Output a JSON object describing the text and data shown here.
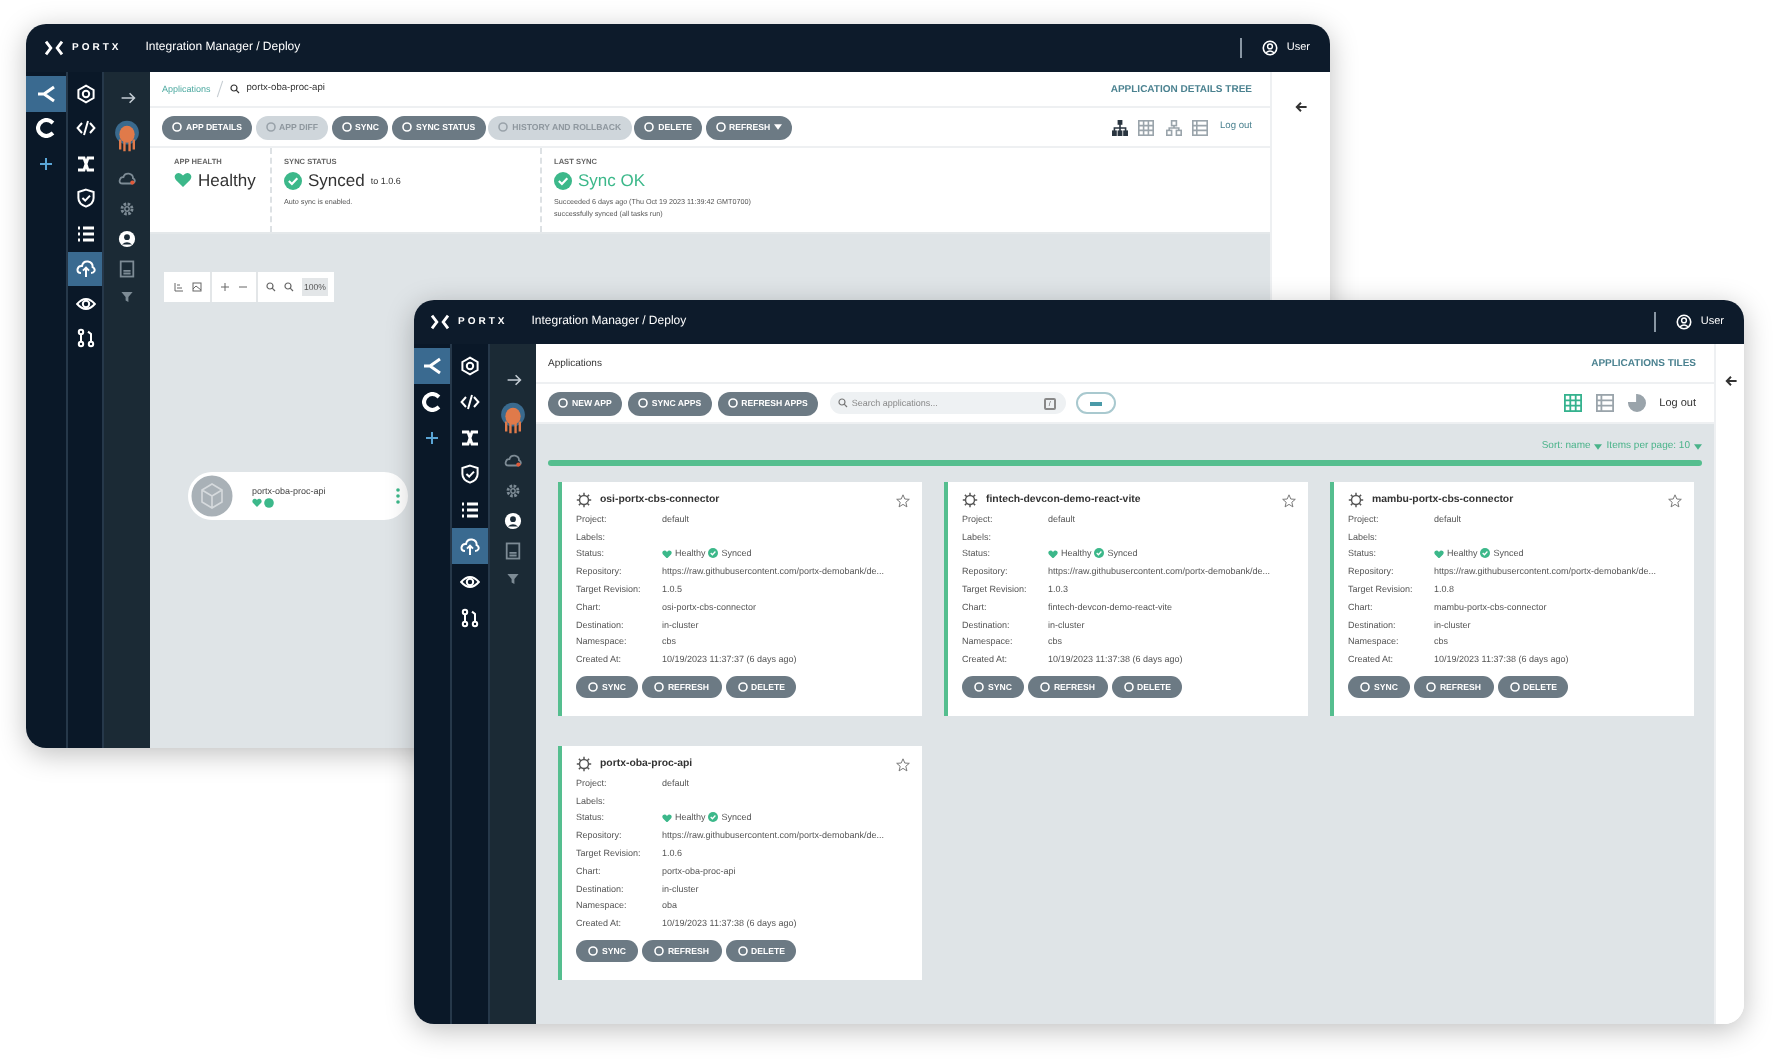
{
  "back_window": {
    "header": {
      "brand": "PORTX",
      "title": "Integration Manager / Deploy",
      "user": "User"
    },
    "primary_nav": [
      {
        "selected": true
      },
      {
        "selected": false
      },
      {
        "selected": false
      }
    ],
    "nav": [
      {
        "selected": false
      },
      {
        "selected": false
      },
      {
        "selected": false
      },
      {
        "selected": false
      },
      {
        "selected": false
      },
      {
        "selected": true
      },
      {
        "selected": false
      },
      {
        "selected": false
      }
    ],
    "breadcrumb": {
      "root": "Applications",
      "current": "portx-oba-proc-api"
    },
    "view_title": "APPLICATION DETAILS TREE",
    "actions": [
      {
        "label": "APP DETAILS",
        "disabled": false
      },
      {
        "label": "APP DIFF",
        "disabled": true
      },
      {
        "label": "SYNC",
        "disabled": false
      },
      {
        "label": "SYNC STATUS",
        "disabled": false
      },
      {
        "label": "HISTORY AND ROLLBACK",
        "disabled": true
      },
      {
        "label": "DELETE",
        "disabled": false
      },
      {
        "label": "REFRESH",
        "disabled": false
      }
    ],
    "views": [
      {
        "selected": true
      },
      {
        "selected": false
      },
      {
        "selected": false
      },
      {
        "selected": false
      }
    ],
    "logout": "Log out",
    "app_health": {
      "label": "APP HEALTH",
      "value": "Healthy"
    },
    "sync_status": {
      "label": "SYNC STATUS",
      "value": "Synced",
      "revision": "to 1.0.6",
      "note": "Auto sync is enabled."
    },
    "last_sync": {
      "label": "LAST SYNC",
      "value": "Sync OK",
      "detail": "Succeeded 6 days ago (Thu Oct 19 2023 11:39:42 GMT0700)",
      "result": "successfully synced (all tasks run)"
    },
    "zoom": "100%",
    "node": {
      "name": "portx-oba-proc-api"
    }
  },
  "front_window": {
    "header": {
      "brand": "PORTX",
      "title": "Integration Manager / Deploy",
      "user": "User"
    },
    "primary_nav": [
      {
        "selected": true
      },
      {
        "selected": false
      },
      {
        "selected": false
      }
    ],
    "nav": [
      {
        "selected": false
      },
      {
        "selected": false
      },
      {
        "selected": false
      },
      {
        "selected": false
      },
      {
        "selected": false
      },
      {
        "selected": true
      },
      {
        "selected": false
      },
      {
        "selected": false
      }
    ],
    "breadcrumb": "Applications",
    "view_title": "APPLICATIONS TILES",
    "actions": [
      {
        "label": "NEW APP"
      },
      {
        "label": "SYNC APPS"
      },
      {
        "label": "REFRESH APPS"
      }
    ],
    "search": {
      "placeholder": "Search applications...",
      "key_hint": "/"
    },
    "views": [
      {
        "selected": true
      },
      {
        "selected": false
      },
      {
        "selected": false
      }
    ],
    "logout": "Log out",
    "sort": {
      "label": "Sort: name",
      "per_page": "Items per page: 10"
    },
    "apps": [
      {
        "name": "osi-portx-cbs-connector",
        "starred": false,
        "fields": [
          {
            "label": "Project:",
            "value": "default"
          },
          {
            "label": "Labels:"
          },
          {
            "label": "Status:",
            "kind": "status",
            "health": "Healthy",
            "sync": "Synced"
          },
          {
            "label": "Repository:",
            "value": "https://raw.githubusercontent.com/portx-demobank/de..."
          },
          {
            "label": "Target Revision:",
            "value": "1.0.5"
          },
          {
            "label": "Chart:",
            "value": "osi-portx-cbs-connector"
          },
          {
            "label": "Destination:",
            "value": "in-cluster"
          },
          {
            "label": "Namespace:",
            "value": "cbs"
          },
          {
            "label": "Created At:",
            "value": "10/19/2023 11:37:37  (6 days ago)"
          }
        ],
        "buttons": [
          "SYNC",
          "REFRESH",
          "DELETE"
        ]
      },
      {
        "name": "fintech-devcon-demo-react-vite",
        "starred": false,
        "fields": [
          {
            "label": "Project:",
            "value": "default"
          },
          {
            "label": "Labels:"
          },
          {
            "label": "Status:",
            "kind": "status",
            "health": "Healthy",
            "sync": "Synced"
          },
          {
            "label": "Repository:",
            "value": "https://raw.githubusercontent.com/portx-demobank/de..."
          },
          {
            "label": "Target Revision:",
            "value": "1.0.3"
          },
          {
            "label": "Chart:",
            "value": "fintech-devcon-demo-react-vite"
          },
          {
            "label": "Destination:",
            "value": "in-cluster"
          },
          {
            "label": "Namespace:",
            "value": "cbs"
          },
          {
            "label": "Created At:",
            "value": "10/19/2023 11:37:38  (6 days ago)"
          }
        ],
        "buttons": [
          "SYNC",
          "REFRESH",
          "DELETE"
        ]
      },
      {
        "name": "mambu-portx-cbs-connector",
        "starred": false,
        "fields": [
          {
            "label": "Project:",
            "value": "default"
          },
          {
            "label": "Labels:"
          },
          {
            "label": "Status:",
            "kind": "status",
            "health": "Healthy",
            "sync": "Synced"
          },
          {
            "label": "Repository:",
            "value": "https://raw.githubusercontent.com/portx-demobank/de..."
          },
          {
            "label": "Target Revision:",
            "value": "1.0.8"
          },
          {
            "label": "Chart:",
            "value": "mambu-portx-cbs-connector"
          },
          {
            "label": "Destination:",
            "value": "in-cluster"
          },
          {
            "label": "Namespace:",
            "value": "cbs"
          },
          {
            "label": "Created At:",
            "value": "10/19/2023 11:37:38  (6 days ago)"
          }
        ],
        "buttons": [
          "SYNC",
          "REFRESH",
          "DELETE"
        ]
      },
      {
        "name": "portx-oba-proc-api",
        "starred": false,
        "fields": [
          {
            "label": "Project:",
            "value": "default"
          },
          {
            "label": "Labels:"
          },
          {
            "label": "Status:",
            "kind": "status",
            "health": "Healthy",
            "sync": "Synced"
          },
          {
            "label": "Repository:",
            "value": "https://raw.githubusercontent.com/portx-demobank/de..."
          },
          {
            "label": "Target Revision:",
            "value": "1.0.6"
          },
          {
            "label": "Chart:",
            "value": "portx-oba-proc-api"
          },
          {
            "label": "Destination:",
            "value": "in-cluster"
          },
          {
            "label": "Namespace:",
            "value": "oba"
          },
          {
            "label": "Created At:",
            "value": "10/19/2023 11:37:38  (6 days ago)"
          }
        ],
        "buttons": [
          "SYNC",
          "REFRESH",
          "DELETE"
        ]
      }
    ]
  }
}
